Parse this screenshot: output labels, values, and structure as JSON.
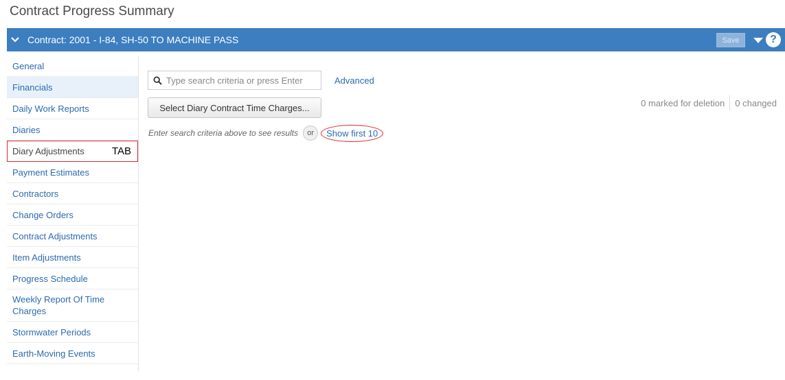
{
  "page": {
    "title": "Contract Progress Summary"
  },
  "header": {
    "contract_label": "Contract: 2001 - I-84, SH-50 TO MACHINE PASS",
    "save_label": "Save",
    "help_label": "?"
  },
  "sidebar": {
    "items": [
      {
        "label": "General"
      },
      {
        "label": "Financials"
      },
      {
        "label": "Daily Work Reports"
      },
      {
        "label": "Diaries"
      },
      {
        "label": "Diary Adjustments"
      },
      {
        "label": "Payment Estimates"
      },
      {
        "label": "Contractors"
      },
      {
        "label": "Change Orders"
      },
      {
        "label": "Contract Adjustments"
      },
      {
        "label": "Item Adjustments"
      },
      {
        "label": "Progress Schedule"
      },
      {
        "label": "Weekly Report Of Time Charges"
      },
      {
        "label": "Stormwater Periods"
      },
      {
        "label": "Earth-Moving Events"
      }
    ],
    "annotation": "TAB"
  },
  "search": {
    "placeholder": "Type search criteria or press Enter",
    "advanced_label": "Advanced"
  },
  "actions": {
    "select_button_label": "Select Diary Contract Time Charges..."
  },
  "status": {
    "marked_for_deletion": "0 marked for deletion",
    "changed": "0 changed"
  },
  "hint": {
    "text": "Enter search criteria above to see results",
    "or_label": "or",
    "show_first_label": "Show first 10"
  },
  "colors": {
    "header_bg": "#3c7ec0",
    "link": "#2a6bb0",
    "highlight": "#d9272e"
  }
}
